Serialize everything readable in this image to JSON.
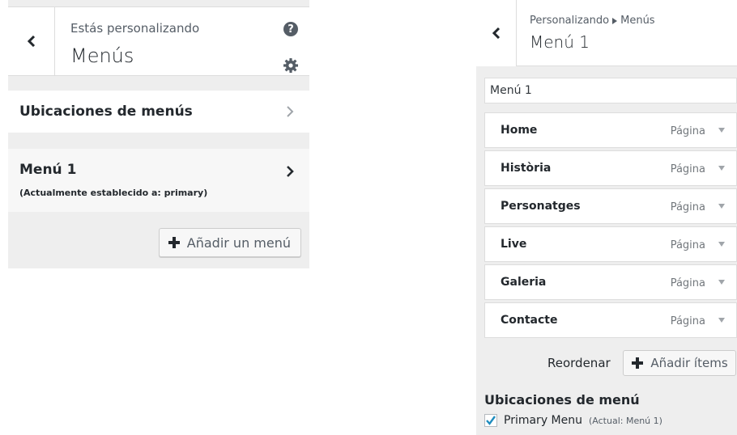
{
  "left_panel": {
    "header": {
      "subtitle": "Estás personalizando",
      "title": "Menús",
      "back_icon": "chevron-left-icon",
      "help_icon": "?",
      "settings_icon": "gear-icon"
    },
    "locations_row": {
      "label": "Ubicaciones de menús"
    },
    "menu_row": {
      "title": "Menú 1",
      "description": "(Actualmente establecido a: primary)"
    },
    "add_menu_button": {
      "label": "Añadir un menú"
    }
  },
  "right_panel": {
    "header": {
      "breadcrumb_parent": "Personalizando",
      "breadcrumb_current": "Menús",
      "title": "Menú 1"
    },
    "menu_name_value": "Menú 1",
    "items": [
      {
        "title": "Home",
        "type": "Página"
      },
      {
        "title": "Història",
        "type": "Página"
      },
      {
        "title": "Personatges",
        "type": "Página"
      },
      {
        "title": "Live",
        "type": "Página"
      },
      {
        "title": "Galeria",
        "type": "Página"
      },
      {
        "title": "Contacte",
        "type": "Página"
      }
    ],
    "reorder_label": "Reordenar",
    "add_items_label": "Añadir ítems",
    "locations_heading": "Ubicaciones de menú",
    "primary_location": {
      "label": "Primary Menu",
      "note": "(Actual: Menú 1)",
      "checked": true
    }
  },
  "colors": {
    "panel_bg": "#eeeeee",
    "header_bg": "#ffffff",
    "check_blue": "#1e8cbe",
    "text_dark": "#23282d"
  }
}
